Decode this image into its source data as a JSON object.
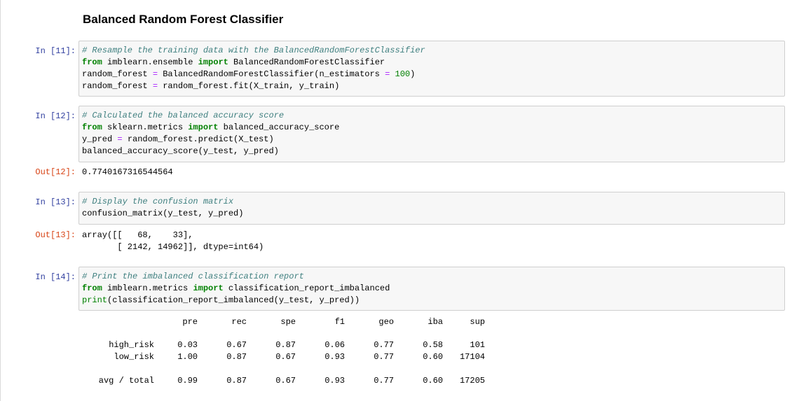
{
  "heading": "Balanced Random Forest Classifier",
  "cells": [
    {
      "prompt": "In  [11]:",
      "lines": [
        [
          {
            "t": "# Resample the training data with the BalancedRandomForestClassifier",
            "c": "cm"
          }
        ],
        [
          {
            "t": "from",
            "c": "kw"
          },
          {
            "t": " imblearn.ensemble "
          },
          {
            "t": "import",
            "c": "kw"
          },
          {
            "t": " BalancedRandomForestClassifier"
          }
        ],
        [
          {
            "t": "random_forest "
          },
          {
            "t": "=",
            "c": "op"
          },
          {
            "t": " BalancedRandomForestClassifier(n_estimators "
          },
          {
            "t": "=",
            "c": "op"
          },
          {
            "t": " "
          },
          {
            "t": "100",
            "c": "num"
          },
          {
            "t": ")"
          }
        ],
        [
          {
            "t": "random_forest "
          },
          {
            "t": "=",
            "c": "op"
          },
          {
            "t": " random_forest.fit(X_train, y_train)"
          }
        ]
      ]
    },
    {
      "prompt": "In  [12]:",
      "lines": [
        [
          {
            "t": "# Calculated the balanced accuracy score",
            "c": "cm"
          }
        ],
        [
          {
            "t": "from",
            "c": "kw"
          },
          {
            "t": " sklearn.metrics "
          },
          {
            "t": "import",
            "c": "kw"
          },
          {
            "t": " balanced_accuracy_score"
          }
        ],
        [
          {
            "t": "y_pred "
          },
          {
            "t": "=",
            "c": "op"
          },
          {
            "t": " random_forest.predict(X_test)"
          }
        ],
        [
          {
            "t": "balanced_accuracy_score(y_test, y_pred)"
          }
        ]
      ]
    },
    {
      "prompt": "In  [13]:",
      "lines": [
        [
          {
            "t": "# Display the confusion matrix",
            "c": "cm"
          }
        ],
        [
          {
            "t": "confusion_matrix(y_test, y_pred)"
          }
        ]
      ]
    },
    {
      "prompt": "In  [14]:",
      "lines": [
        [
          {
            "t": "# Print the imbalanced classification report",
            "c": "cm"
          }
        ],
        [
          {
            "t": "from",
            "c": "kw"
          },
          {
            "t": " imblearn.metrics "
          },
          {
            "t": "import",
            "c": "kw"
          },
          {
            "t": " classification_report_imbalanced"
          }
        ],
        [
          {
            "t": "print",
            "c": "bi"
          },
          {
            "t": "(classification_report_imbalanced(y_test, y_pred))"
          }
        ]
      ]
    }
  ],
  "outputs": [
    {
      "prompt": "Out[12]:",
      "text": "0.7740167316544564"
    },
    {
      "prompt": "Out[13]:",
      "text": "array([[   68,    33],\n       [ 2142, 14962]], dtype=int64)"
    }
  ],
  "report": {
    "columns": [
      "pre",
      "rec",
      "spe",
      "f1",
      "geo",
      "iba",
      "sup"
    ],
    "rows": [
      {
        "label": "high_risk",
        "values": [
          "0.03",
          "0.67",
          "0.87",
          "0.06",
          "0.77",
          "0.58",
          "101"
        ]
      },
      {
        "label": "low_risk",
        "values": [
          "1.00",
          "0.87",
          "0.67",
          "0.93",
          "0.77",
          "0.60",
          "17104"
        ]
      },
      {
        "label": "avg / total",
        "values": [
          "0.99",
          "0.87",
          "0.67",
          "0.93",
          "0.77",
          "0.60",
          "17205"
        ]
      }
    ]
  }
}
